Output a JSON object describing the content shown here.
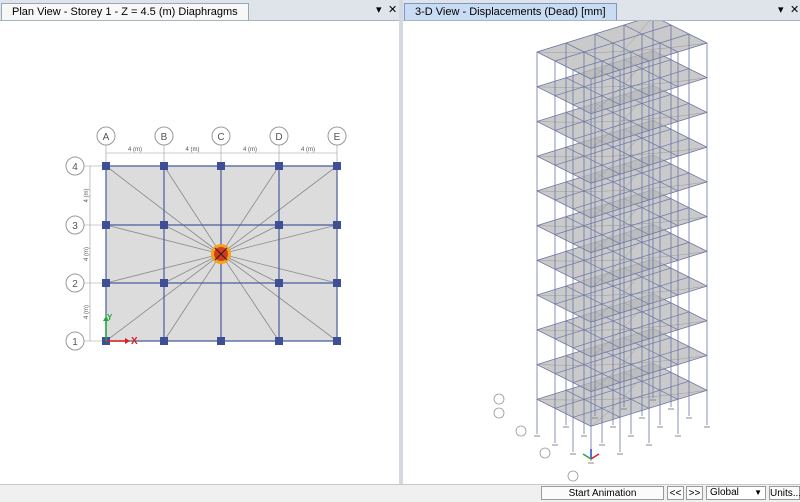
{
  "left_tab": {
    "title": "Plan View - Storey 1 - Z = 4.5 (m)  Diaphragms"
  },
  "right_tab": {
    "title": "3-D View   - Displacements (Dead)  [mm]"
  },
  "window_controls": {
    "menu": "▾",
    "close": "✕"
  },
  "plan": {
    "column_labels": [
      "A",
      "B",
      "C",
      "D",
      "E"
    ],
    "row_labels": [
      "4",
      "3",
      "2",
      "1"
    ],
    "bay_dims": [
      "4 (m)",
      "4 (m)",
      "4 (m)",
      "4 (m)"
    ],
    "story_dims": [
      "4 (m)",
      "4 (m)",
      "4 (m)"
    ],
    "axis_x": "X",
    "axis_y": "Y"
  },
  "statusbar": {
    "start_animation": "Start Animation",
    "prev": "<<",
    "next": ">>",
    "coord_system": "Global",
    "units": "Units..."
  },
  "colors": {
    "grid_line": "#4a5c9c",
    "column": "#3e4f95",
    "slab": "#dcdcdc",
    "cm_marker": "#d43c1e"
  }
}
